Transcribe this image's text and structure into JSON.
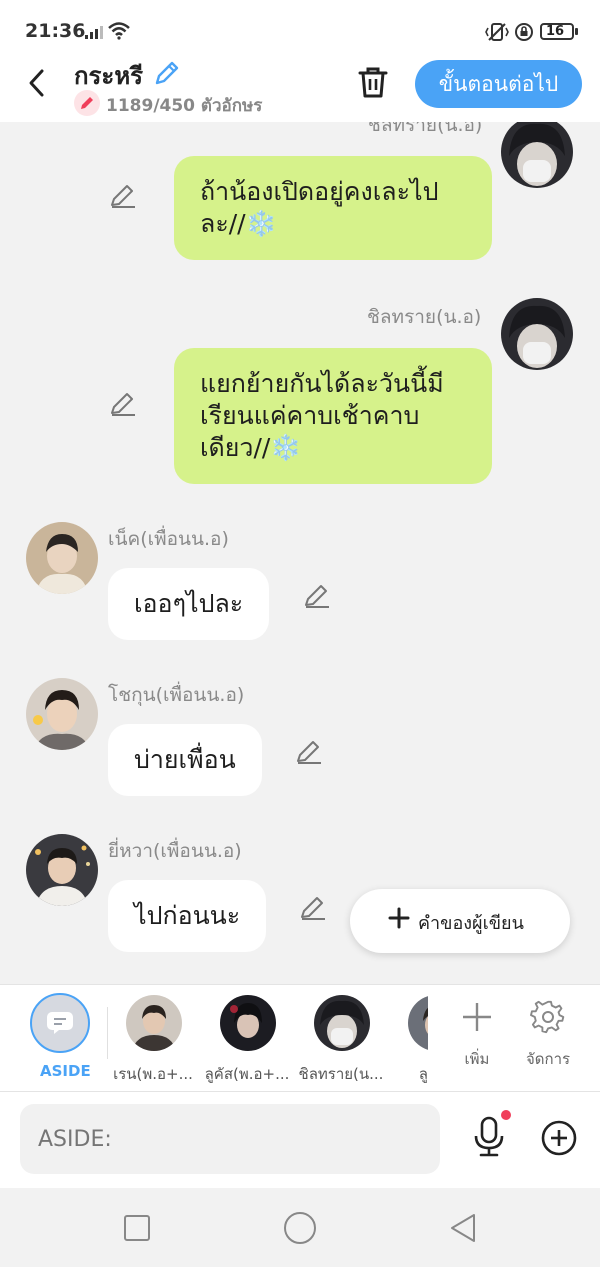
{
  "status": {
    "time": "21:36",
    "battery": "16"
  },
  "header": {
    "title": "กระหรี",
    "char_count": "1189/450 ตัวอักษร",
    "next_label": "ขั้นตอนต่อไป"
  },
  "messages": [
    {
      "side": "right",
      "sender": "ชิลทราย(น.อ)",
      "text": "ถ้าน้องเปิดอยู่คงเละไปละ//❄️"
    },
    {
      "side": "right",
      "sender": "ชิลทราย(น.อ)",
      "text": "แยกย้ายกันได้ละวันนี้มีเรียนแค่คาบเช้าคาบเดียว//❄️"
    },
    {
      "side": "left",
      "sender": "เน็ค(เพื่อนน.อ)",
      "text": "เออๆไปละ"
    },
    {
      "side": "left",
      "sender": "โชกุน(เพื่อนน.อ)",
      "text": "บ่ายเพื่อน"
    },
    {
      "side": "left",
      "sender": "ยี่หวา(เพื่อนน.อ)",
      "text": "ไปก่อนนะ"
    }
  ],
  "author_words_label": "คำของผู้เขียน",
  "characters": {
    "aside_label": "ASIDE",
    "items": [
      {
        "name": "เรน(พ.อ+..."
      },
      {
        "name": "ลูคัส(พ.อ+..."
      },
      {
        "name": "ชิลทราย(น..."
      },
      {
        "name": "ลูก้า("
      }
    ],
    "add_label": "เพิ่ม",
    "manage_label": "จัดการ"
  },
  "input": {
    "placeholder": "ASIDE:"
  },
  "colors": {
    "accent": "#4aa3f6",
    "bubble_right": "#d6f28b",
    "bubble_left": "#ffffff"
  }
}
